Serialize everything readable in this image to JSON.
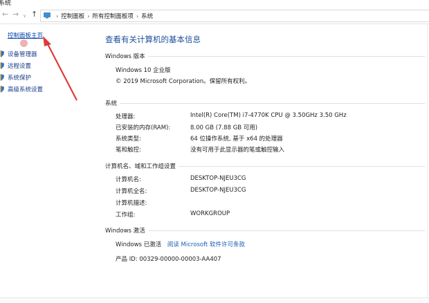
{
  "window": {
    "title": "系统"
  },
  "nav": {
    "breadcrumbs": [
      "控制面板",
      "所有控制面板项",
      "系统"
    ]
  },
  "left_pane": {
    "home_link": "控制面板主页",
    "items": [
      {
        "label": "设备管理器",
        "icon": "shield-icon"
      },
      {
        "label": "远程设置",
        "icon": "shield-icon"
      },
      {
        "label": "系统保护",
        "icon": "shield-icon"
      },
      {
        "label": "高级系统设置",
        "icon": "shield-icon"
      }
    ]
  },
  "main": {
    "heading": "查看有关计算机的基本信息",
    "edition": {
      "section_title": "Windows 版本",
      "name": "Windows 10 企业版",
      "copyright": "© 2019 Microsoft Corporation。保留所有权利。"
    },
    "system": {
      "section_title": "系统",
      "rows": [
        {
          "key": "处理器:",
          "value": "Intel(R) Core(TM) i7-4770K CPU @ 3.50GHz   3.50 GHz"
        },
        {
          "key": "已安装的内存(RAM):",
          "value": "8.00 GB (7.88 GB 可用)"
        },
        {
          "key": "系统类型:",
          "value": "64 位操作系统, 基于 x64 的处理器"
        },
        {
          "key": "笔和触控:",
          "value": "没有可用于此显示器的笔或触控输入"
        }
      ]
    },
    "computer": {
      "section_title": "计算机名、域和工作组设置",
      "rows": [
        {
          "key": "计算机名:",
          "value": "DESKTOP-NJEU3CG"
        },
        {
          "key": "计算机全名:",
          "value": "DESKTOP-NJEU3CG"
        },
        {
          "key": "计算机描述:",
          "value": ""
        },
        {
          "key": "工作组:",
          "value": "WORKGROUP"
        }
      ]
    },
    "activation": {
      "section_title": "Windows 激活",
      "status": "Windows 已激活",
      "license_link": "阅读 Microsoft 软件许可条款",
      "product_id": "产品 ID: 00329-00000-00003-AA407"
    }
  },
  "colors": {
    "link": "#1a5fb4",
    "heading": "#1e4d9b",
    "annotation_arrow": "#e03a3a"
  }
}
